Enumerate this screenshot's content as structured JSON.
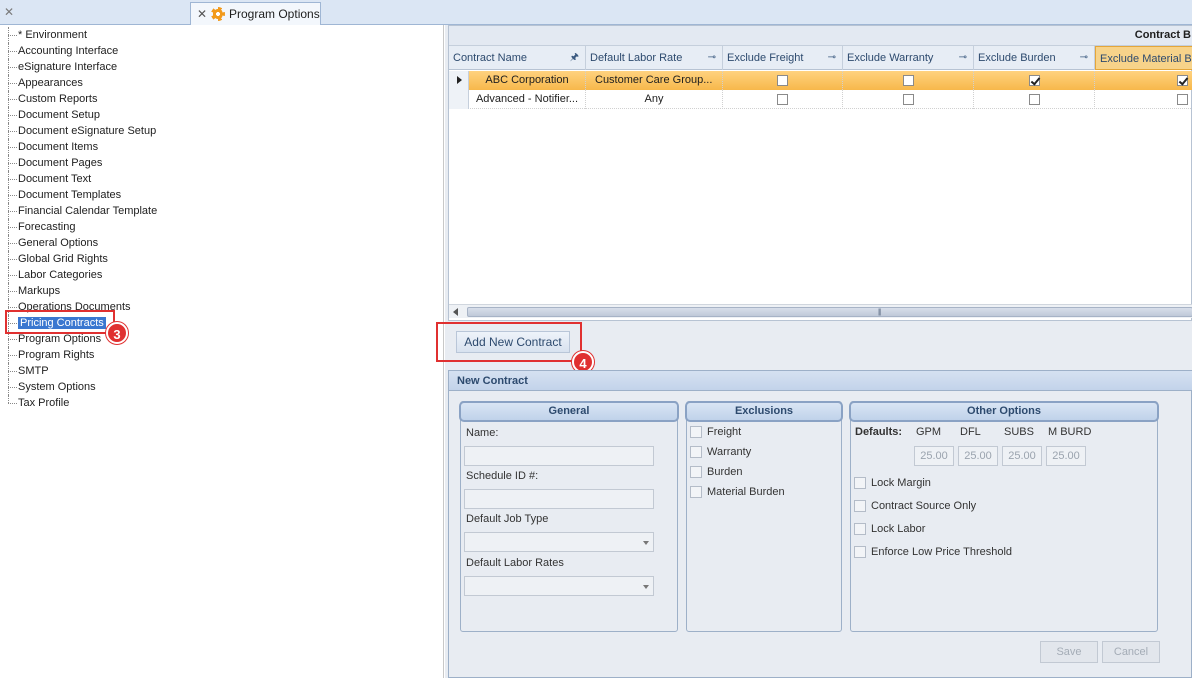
{
  "tabs": {
    "close_icon": "close-icon",
    "active_tab": {
      "label": "Program Options",
      "icon": "gear-icon"
    }
  },
  "tree": {
    "items": [
      "* Environment",
      "Accounting Interface",
      "eSignature Interface",
      "Appearances",
      "Custom Reports",
      "Document Setup",
      "Document eSignature Setup",
      "Document Items",
      "Document Pages",
      "Document Text",
      "Document Templates",
      "Financial Calendar Template",
      "Forecasting",
      "General Options",
      "Global Grid Rights",
      "Labor Categories",
      "Markups",
      "Operations Documents",
      "Pricing Contracts",
      "Program Options",
      "Program Rights",
      "SMTP",
      "System Options",
      "Tax Profile"
    ],
    "selected": "Pricing Contracts"
  },
  "callouts": {
    "pricing": "3",
    "add": "4"
  },
  "grid": {
    "band_title": "Contract B",
    "columns": [
      "Contract Name",
      "Default Labor Rate",
      "Exclude Freight",
      "Exclude Warranty",
      "Exclude Burden",
      "Exclude Material B"
    ],
    "rows": [
      {
        "name": "ABC Corporation",
        "rate": "Customer Care Group...",
        "freight": false,
        "warranty": false,
        "burden": true,
        "material": true
      },
      {
        "name": "Advanced - Notifier...",
        "rate": "Any",
        "freight": false,
        "warranty": false,
        "burden": false,
        "material": false
      }
    ]
  },
  "add_button": "Add New Contract",
  "new_contract": {
    "title": "New Contract",
    "general": {
      "title": "General",
      "name_label": "Name:",
      "schedule_label": "Schedule ID #:",
      "job_type_label": "Default Job Type",
      "labor_rates_label": "Default Labor Rates"
    },
    "exclusions": {
      "title": "Exclusions",
      "items": [
        "Freight",
        "Warranty",
        "Burden",
        "Material Burden"
      ]
    },
    "other": {
      "title": "Other Options",
      "defaults_label": "Defaults:",
      "headers": [
        "GPM",
        "DFL",
        "SUBS",
        "M BURD"
      ],
      "values": [
        "25.00",
        "25.00",
        "25.00",
        "25.00"
      ],
      "checks": [
        "Lock Margin",
        "Contract Source Only",
        "Lock Labor",
        "Enforce Low Price Threshold"
      ]
    },
    "save": "Save",
    "cancel": "Cancel"
  },
  "colors": {
    "accent": "#e03030",
    "selected_row": "#f7b84b",
    "tree_selected": "#3a77d0"
  }
}
